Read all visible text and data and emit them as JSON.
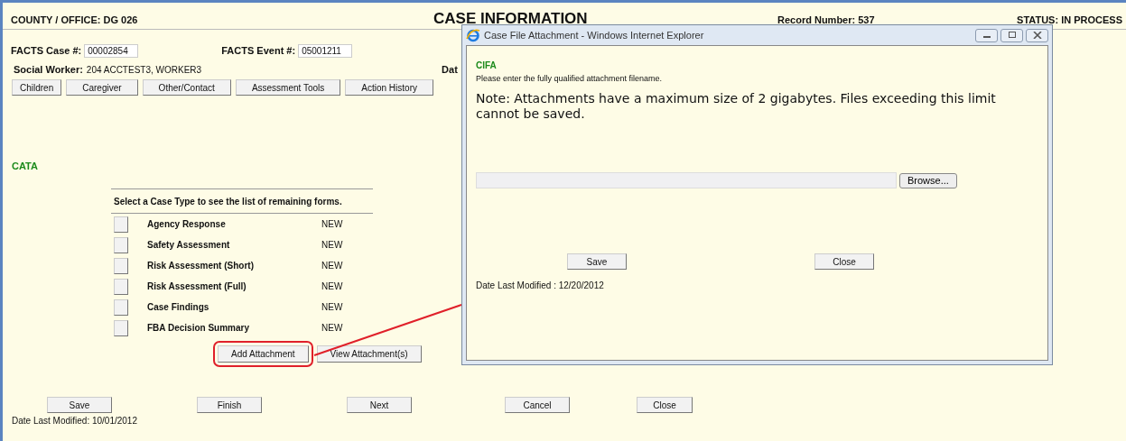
{
  "header": {
    "county_office": "COUNTY / OFFICE: DG 026",
    "title": "CASE INFORMATION",
    "record_number": "Record Number: 537",
    "status": "STATUS: IN PROCESS"
  },
  "case_fields": [
    {
      "label": "FACTS Case #:",
      "value": "00002854"
    },
    {
      "label": "FACTS Event #:",
      "value": "05001211"
    }
  ],
  "social_worker": {
    "label": "Social Worker:",
    "value": "204 ACCTEST3, WORKER3"
  },
  "date_label_partial": "Dat",
  "nav_buttons": [
    "Children",
    "Caregiver",
    "Other/Contact",
    "Assessment Tools",
    "Action History"
  ],
  "section_label": "CATA",
  "instructions": "Select a Case Type to see the list of remaining forms.",
  "forms": [
    {
      "name": "Agency Response",
      "status": "NEW"
    },
    {
      "name": "Safety Assessment",
      "status": "NEW"
    },
    {
      "name": "Risk Assessment (Short)",
      "status": "NEW"
    },
    {
      "name": "Risk Assessment (Full)",
      "status": "NEW"
    },
    {
      "name": "Case Findings",
      "status": "NEW"
    },
    {
      "name": "FBA Decision Summary",
      "status": "NEW"
    }
  ],
  "attachment_buttons": [
    "Add Attachment",
    "View Attachment(s)"
  ],
  "bottom_buttons": [
    "Save",
    "Finish",
    "Next",
    "Cancel",
    "Close"
  ],
  "date_modified": "Date Last Modified: 10/01/2012",
  "popup": {
    "title": "Case File Attachment - Windows Internet Explorer",
    "section_label": "CIFA",
    "instruction": "Please enter the fully qualified attachment filename.",
    "note": "Note: Attachments have a maximum size of 2 gigabytes. Files exceeding this limit cannot be saved.",
    "browse_button": "Browse...",
    "buttons": [
      "Save",
      "Close"
    ],
    "date_modified": "Date Last Modified : 12/20/2012"
  }
}
